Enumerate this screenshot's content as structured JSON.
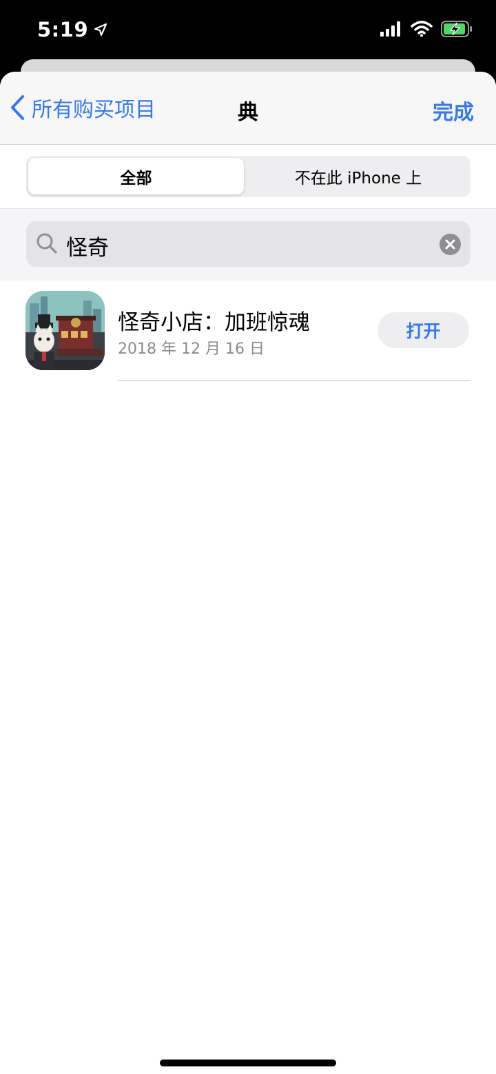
{
  "status_bar": {
    "time": "5:19"
  },
  "nav": {
    "back_label": "所有购买项目",
    "title": "典",
    "done_label": "完成"
  },
  "segments": [
    {
      "label": "全部",
      "selected": true
    },
    {
      "label": "不在此 iPhone 上",
      "selected": false
    }
  ],
  "search": {
    "query": "怪奇"
  },
  "apps": [
    {
      "name": "怪奇小店：加班惊魂",
      "date": "2018 年 12 月 16 日",
      "action_label": "打开"
    }
  ],
  "colors": {
    "accent": "#3478f6",
    "secondary_text": "#8a8a8e",
    "control_bg": "#eeeef0"
  }
}
